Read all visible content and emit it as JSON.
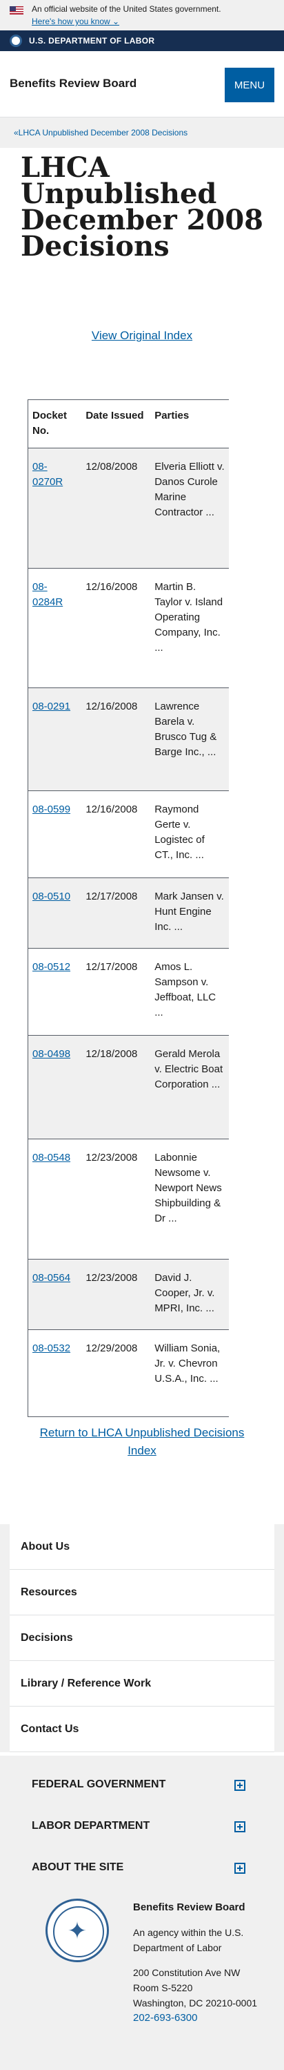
{
  "gov_banner": {
    "official_text": "An official website of the United States government.",
    "how_link": "Here's how you know ⌄"
  },
  "dol_bar": {
    "text": "U.S. DEPARTMENT OF LABOR"
  },
  "header": {
    "site_title": "Benefits Review Board",
    "menu_label": "MENU"
  },
  "breadcrumb": {
    "text": "«LHCA Unpublished December 2008 Decisions"
  },
  "page_title": "LHCA Unpublished December 2008 Decisions",
  "view_index_label": "View Original Index",
  "table": {
    "headers": [
      "Docket No.",
      "Date Issued",
      "Parties"
    ],
    "rows": [
      {
        "docket": "08-0270R",
        "date": "12/08/2008",
        "parties": "Elveria Elliott v. Danos Curole Marine Contractor ..."
      },
      {
        "docket": "08-0284R",
        "date": "12/16/2008",
        "parties": "Martin B. Taylor v. Island Operating Company, Inc. ..."
      },
      {
        "docket": "08-0291",
        "date": "12/16/2008",
        "parties": "Lawrence Barela v. Brusco Tug & Barge Inc., ..."
      },
      {
        "docket": "08-0599",
        "date": "12/16/2008",
        "parties": "Raymond Gerte v. Logistec of CT., Inc. ..."
      },
      {
        "docket": "08-0510",
        "date": "12/17/2008",
        "parties": "Mark Jansen v. Hunt Engine Inc. ..."
      },
      {
        "docket": "08-0512",
        "date": "12/17/2008",
        "parties": "Amos L. Sampson v. Jeffboat, LLC ..."
      },
      {
        "docket": "08-0498",
        "date": "12/18/2008",
        "parties": "Gerald Merola v. Electric Boat Corporation ..."
      },
      {
        "docket": "08-0548",
        "date": "12/23/2008",
        "parties": "Labonnie Newsome v. Newport News Shipbuilding & Dr ..."
      },
      {
        "docket": "08-0564",
        "date": "12/23/2008",
        "parties": "David J. Cooper, Jr. v. MPRI, Inc. ..."
      },
      {
        "docket": "08-0532",
        "date": "12/29/2008",
        "parties": "William Sonia, Jr. v. Chevron U.S.A., Inc. ..."
      }
    ]
  },
  "return_link": "Return to LHCA Unpublished Decisions Index",
  "footer_nav": [
    "About Us",
    "Resources",
    "Decisions",
    "Library / Reference Work",
    "Contact Us"
  ],
  "footer_sections": [
    "FEDERAL GOVERNMENT",
    "LABOR DEPARTMENT",
    "ABOUT THE SITE"
  ],
  "footer_address": {
    "title": "Benefits Review Board",
    "agency": "An agency within the U.S. Department of Labor",
    "street": "200 Constitution Ave NW",
    "room": "Room S-5220",
    "city": "Washington, DC 20210-0001",
    "phone": "202-693-6300"
  }
}
